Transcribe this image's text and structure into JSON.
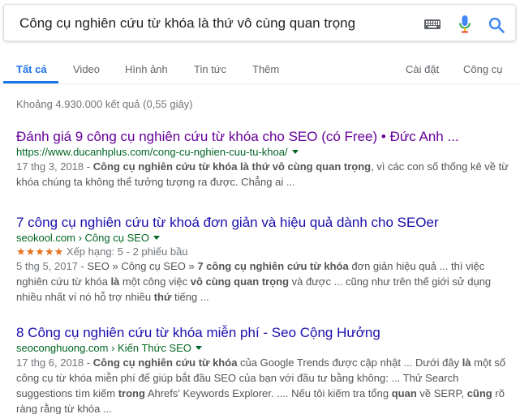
{
  "search": {
    "query": "Công cụ nghiên cứu từ khóa là thứ vô cùng quan trọng"
  },
  "icons": {
    "keyboard": "keyboard-icon",
    "mic": "mic-icon",
    "search": "search-icon"
  },
  "colors": {
    "accent_blue": "#1a73e8",
    "link": "#1a0dab",
    "visited_link": "#660099",
    "url_green": "#006621",
    "star_orange": "#e7711b"
  },
  "tabs": {
    "all": "Tất cả",
    "video": "Video",
    "images": "Hình ảnh",
    "news": "Tin tức",
    "more": "Thêm",
    "settings": "Cài đặt",
    "tools": "Công cụ"
  },
  "stats": "Khoảng 4.930.000 kết quả (0,55 giây)",
  "results": [
    {
      "title": "Đánh giá 9 công cụ nghiên cứu từ khóa cho SEO (có Free) • Đức Anh ...",
      "url": "https://www.ducanhplus.com/cong-cu-nghien-cuu-tu-khoa/",
      "date": "17 thg 3, 2018",
      "snippet": [
        {
          "t": " - ",
          "b": false
        },
        {
          "t": "Công cụ nghiên cứu từ khóa là thứ vô cùng quan trọng",
          "b": true
        },
        {
          "t": ", vì các con số thống kê về từ khóa chúng ta không thể tưởng tượng ra được. Chẳng ai ...",
          "b": false
        }
      ]
    },
    {
      "title": "7 công cụ nghiên cứu từ khoá đơn giản và hiệu quả dành cho SEOer",
      "url_domain": "seokool.com",
      "url_sep": " › ",
      "url_path": "Công cụ SEO",
      "stars": "★★★★★",
      "rating": "Xếp hạng: 5 - 2 phiếu bầu",
      "date": "5 thg 5, 2017",
      "snippet": [
        {
          "t": " - SEO » Công cụ SEO » ",
          "b": false
        },
        {
          "t": "7 công cụ nghiên cứu từ khóa",
          "b": true
        },
        {
          "t": " đơn giản hiệu quả ... thì việc nghiên cứu từ khóa ",
          "b": false
        },
        {
          "t": "là",
          "b": true
        },
        {
          "t": " một công việc ",
          "b": false
        },
        {
          "t": "vô cùng quan trọng",
          "b": true
        },
        {
          "t": " và được ... cũng như trên thế giới sử dụng nhiều nhất ví nó hỗ trợ nhiều ",
          "b": false
        },
        {
          "t": "thứ",
          "b": true
        },
        {
          "t": " tiếng ...",
          "b": false
        }
      ]
    },
    {
      "title": "8 Công cụ nghiên cứu từ khóa miễn phí - Seo Cộng Hưởng",
      "url_domain": "seoconghuong.com",
      "url_sep": " › ",
      "url_path": "Kiến Thức SEO",
      "date": "17 thg 6, 2018",
      "snippet": [
        {
          "t": " - ",
          "b": false
        },
        {
          "t": "Công cụ nghiên cứu từ khóa",
          "b": true
        },
        {
          "t": " của Google Trends được cập nhật ... Dưới đây ",
          "b": false
        },
        {
          "t": "là",
          "b": true
        },
        {
          "t": " một số công cụ từ khóa miễn phí để giúp bắt đầu SEO của bạn với đầu tư bằng không: ... Thử Search suggestions tìm kiếm ",
          "b": false
        },
        {
          "t": "trong",
          "b": true
        },
        {
          "t": " Ahrefs' Keywords Explorer. .... Nếu tôi kiếm tra tổng ",
          "b": false
        },
        {
          "t": "quan",
          "b": true
        },
        {
          "t": " về SERP, ",
          "b": false
        },
        {
          "t": "cũng",
          "b": true
        },
        {
          "t": " rõ ràng rằng từ khóa ...",
          "b": false
        }
      ]
    }
  ]
}
